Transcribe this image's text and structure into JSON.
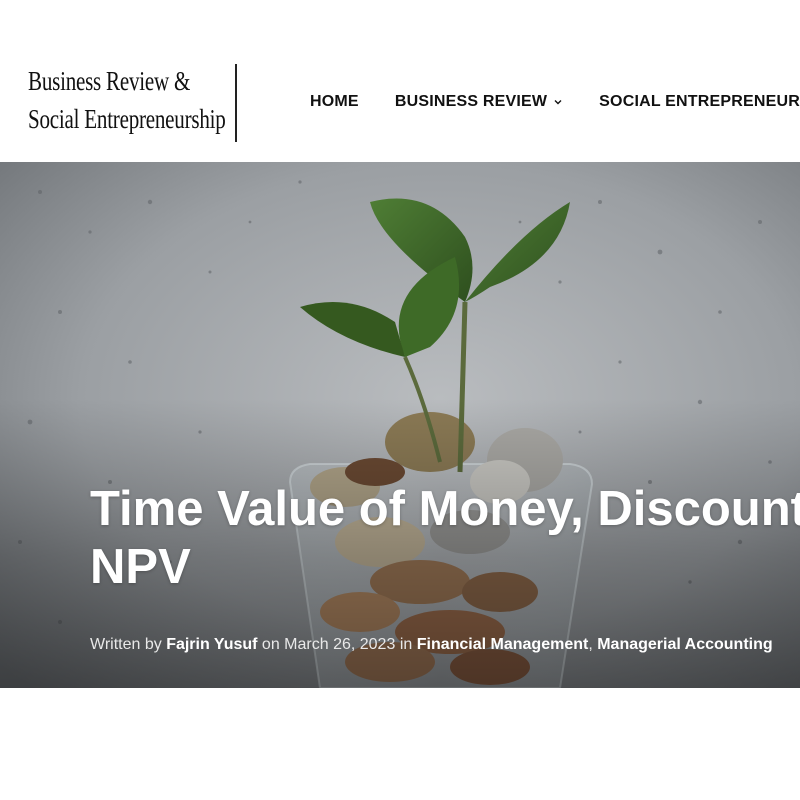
{
  "site": {
    "logo_line1": "Business Review &",
    "logo_line2": "Social Entrepreneurship"
  },
  "nav": {
    "items": [
      {
        "label": "HOME",
        "has_dropdown": false
      },
      {
        "label": "BUSINESS REVIEW",
        "has_dropdown": true
      },
      {
        "label": "SOCIAL ENTREPRENEURSHIP",
        "has_dropdown": false
      }
    ]
  },
  "post": {
    "title_line1": "Time Value of Money, Discount Rate, and",
    "title_line2": "NPV",
    "meta": {
      "written_by": "Written by",
      "author": "Fajrin Yusuf",
      "on": "on",
      "date": "March 26, 2023",
      "in": "in",
      "category1": "Financial Management",
      "separator": ",",
      "category2": "Managerial Accounting"
    }
  },
  "hero_image": {
    "subject": "plant sprouting from jar of coins",
    "colors": {
      "wall": "#9a9ea2",
      "leaf": "#3f6b2a",
      "coin": "#a88a66"
    }
  },
  "icons": {
    "dropdown": "chevron-down-icon"
  }
}
